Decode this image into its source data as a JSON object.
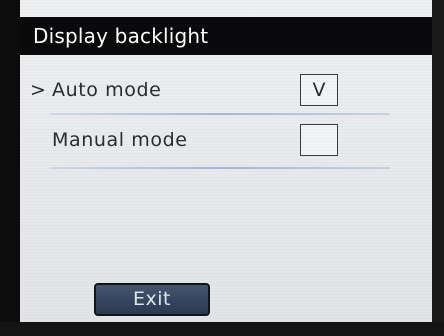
{
  "screen": {
    "title": "Display backlight",
    "options": [
      {
        "cursor": ">",
        "label": "Auto mode",
        "checked_mark": "V",
        "selected": true
      },
      {
        "cursor": "",
        "label": "Manual mode",
        "checked_mark": "",
        "selected": false
      }
    ],
    "exit_label": "Exit"
  }
}
